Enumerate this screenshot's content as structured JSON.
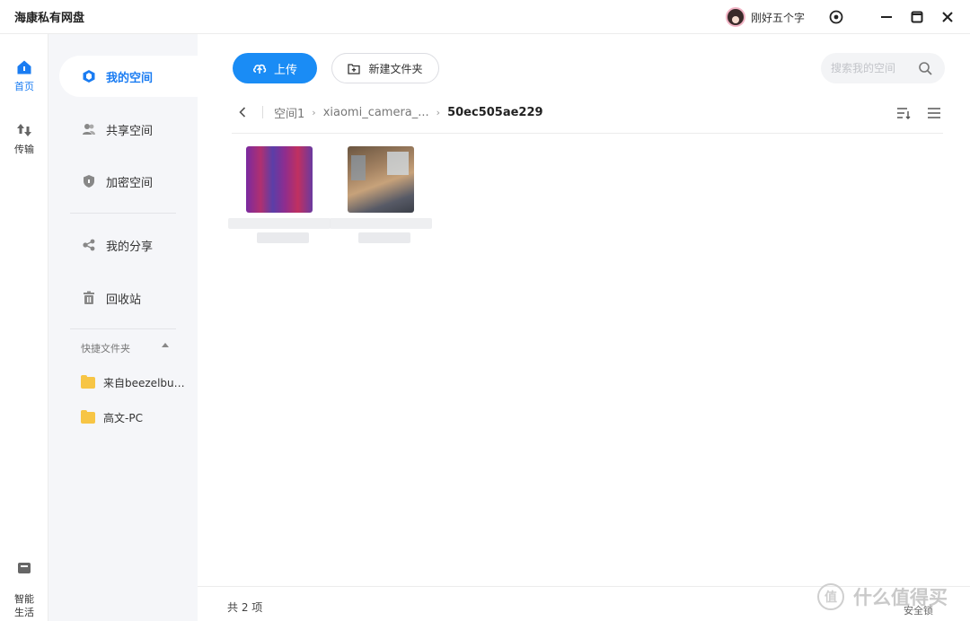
{
  "app": {
    "title": "海康私有网盘",
    "user_name": "刚好五个字"
  },
  "rail": {
    "home_label": "首页",
    "transfer_label": "传输",
    "smart_life_label": "智能\n生活"
  },
  "sidebar": {
    "items": [
      {
        "label": "我的空间",
        "icon": "cube-icon",
        "active": true
      },
      {
        "label": "共享空间",
        "icon": "users-icon"
      },
      {
        "label": "加密空间",
        "icon": "shield-icon"
      },
      {
        "label": "我的分享",
        "icon": "share-icon"
      },
      {
        "label": "回收站",
        "icon": "trash-icon"
      }
    ],
    "quick_folders_title": "快捷文件夹",
    "quick_folders": [
      {
        "label": "来自beezelbub..."
      },
      {
        "label": "高文-PC"
      }
    ]
  },
  "toolbar": {
    "upload_label": "上传",
    "new_folder_label": "新建文件夹",
    "search_placeholder": "搜索我的空间"
  },
  "breadcrumb": {
    "items": [
      "空间1",
      "xiaomi_camera_..."
    ],
    "current": "50ec505ae229"
  },
  "files": [
    {
      "thumb": "purple-noise"
    },
    {
      "thumb": "living-room"
    }
  ],
  "footer": {
    "count": "共 2 项",
    "watermark": "什么值得买",
    "watermark_badge": "值",
    "bottom_right": "安全锁"
  },
  "colors": {
    "accent": "#1a8cf5",
    "sidebar_bg": "#f5f6f9",
    "folder": "#f7c545"
  }
}
